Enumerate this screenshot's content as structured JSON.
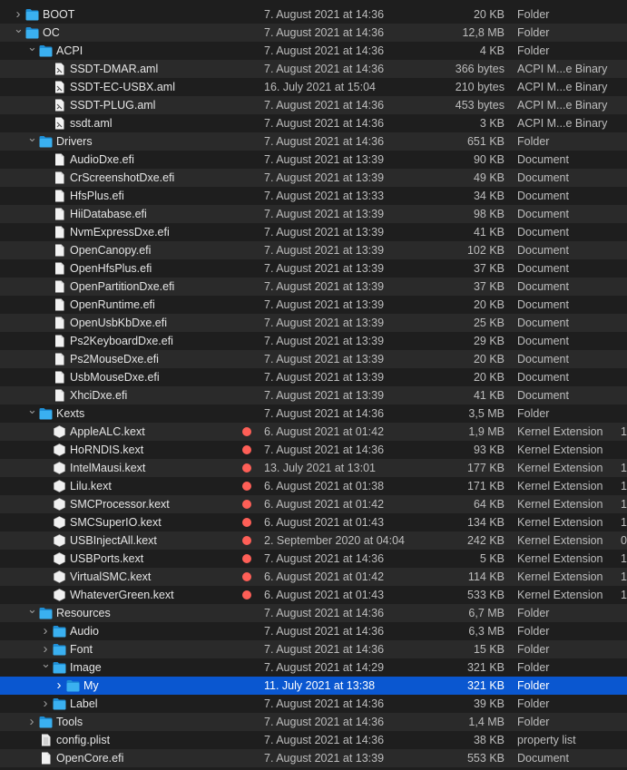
{
  "colors": {
    "folder": "#3ab0f0",
    "selection": "#0a57d0",
    "tag_red": "#fe5f57"
  },
  "rows": [
    {
      "level": 0,
      "icon": "folder",
      "disclosure": "collapsed",
      "name": "BOOT",
      "date": "7. August 2021 at 14:36",
      "size": "20 KB",
      "kind": "Folder"
    },
    {
      "level": 0,
      "icon": "folder",
      "disclosure": "expanded",
      "name": "OC",
      "date": "7. August 2021 at 14:36",
      "size": "12,8 MB",
      "kind": "Folder"
    },
    {
      "level": 1,
      "icon": "folder",
      "disclosure": "expanded",
      "name": "ACPI",
      "date": "7. August 2021 at 14:36",
      "size": "4 KB",
      "kind": "Folder"
    },
    {
      "level": 2,
      "icon": "aml",
      "name": "SSDT-DMAR.aml",
      "date": "7. August 2021 at 14:36",
      "size": "366 bytes",
      "kind": "ACPI M...e Binary"
    },
    {
      "level": 2,
      "icon": "aml",
      "name": "SSDT-EC-USBX.aml",
      "date": "16. July 2021 at 15:04",
      "size": "210 bytes",
      "kind": "ACPI M...e Binary"
    },
    {
      "level": 2,
      "icon": "aml",
      "name": "SSDT-PLUG.aml",
      "date": "7. August 2021 at 14:36",
      "size": "453 bytes",
      "kind": "ACPI M...e Binary"
    },
    {
      "level": 2,
      "icon": "aml",
      "name": "ssdt.aml",
      "date": "7. August 2021 at 14:36",
      "size": "3 KB",
      "kind": "ACPI M...e Binary"
    },
    {
      "level": 1,
      "icon": "folder",
      "disclosure": "expanded",
      "name": "Drivers",
      "date": "7. August 2021 at 14:36",
      "size": "651 KB",
      "kind": "Folder"
    },
    {
      "level": 2,
      "icon": "doc",
      "name": "AudioDxe.efi",
      "date": "7. August 2021 at 13:39",
      "size": "90 KB",
      "kind": "Document"
    },
    {
      "level": 2,
      "icon": "doc",
      "name": "CrScreenshotDxe.efi",
      "date": "7. August 2021 at 13:39",
      "size": "49 KB",
      "kind": "Document"
    },
    {
      "level": 2,
      "icon": "doc",
      "name": "HfsPlus.efi",
      "date": "7. August 2021 at 13:33",
      "size": "34 KB",
      "kind": "Document"
    },
    {
      "level": 2,
      "icon": "doc",
      "name": "HiiDatabase.efi",
      "date": "7. August 2021 at 13:39",
      "size": "98 KB",
      "kind": "Document"
    },
    {
      "level": 2,
      "icon": "doc",
      "name": "NvmExpressDxe.efi",
      "date": "7. August 2021 at 13:39",
      "size": "41 KB",
      "kind": "Document"
    },
    {
      "level": 2,
      "icon": "doc",
      "name": "OpenCanopy.efi",
      "date": "7. August 2021 at 13:39",
      "size": "102 KB",
      "kind": "Document"
    },
    {
      "level": 2,
      "icon": "doc",
      "name": "OpenHfsPlus.efi",
      "date": "7. August 2021 at 13:39",
      "size": "37 KB",
      "kind": "Document"
    },
    {
      "level": 2,
      "icon": "doc",
      "name": "OpenPartitionDxe.efi",
      "date": "7. August 2021 at 13:39",
      "size": "37 KB",
      "kind": "Document"
    },
    {
      "level": 2,
      "icon": "doc",
      "name": "OpenRuntime.efi",
      "date": "7. August 2021 at 13:39",
      "size": "20 KB",
      "kind": "Document"
    },
    {
      "level": 2,
      "icon": "doc",
      "name": "OpenUsbKbDxe.efi",
      "date": "7. August 2021 at 13:39",
      "size": "25 KB",
      "kind": "Document"
    },
    {
      "level": 2,
      "icon": "doc",
      "name": "Ps2KeyboardDxe.efi",
      "date": "7. August 2021 at 13:39",
      "size": "29 KB",
      "kind": "Document"
    },
    {
      "level": 2,
      "icon": "doc",
      "name": "Ps2MouseDxe.efi",
      "date": "7. August 2021 at 13:39",
      "size": "20 KB",
      "kind": "Document"
    },
    {
      "level": 2,
      "icon": "doc",
      "name": "UsbMouseDxe.efi",
      "date": "7. August 2021 at 13:39",
      "size": "20 KB",
      "kind": "Document"
    },
    {
      "level": 2,
      "icon": "doc",
      "name": "XhciDxe.efi",
      "date": "7. August 2021 at 13:39",
      "size": "41 KB",
      "kind": "Document"
    },
    {
      "level": 1,
      "icon": "folder",
      "disclosure": "expanded",
      "name": "Kexts",
      "date": "7. August 2021 at 14:36",
      "size": "3,5 MB",
      "kind": "Folder"
    },
    {
      "level": 2,
      "icon": "kext",
      "tag": "red",
      "name": "AppleALC.kext",
      "date": "6. August 2021 at 01:42",
      "size": "1,9 MB",
      "kind": "Kernel Extension",
      "extra": "1"
    },
    {
      "level": 2,
      "icon": "kext",
      "tag": "red",
      "name": "HoRNDIS.kext",
      "date": "7. August 2021 at 14:36",
      "size": "93 KB",
      "kind": "Kernel Extension"
    },
    {
      "level": 2,
      "icon": "kext",
      "tag": "red",
      "name": "IntelMausi.kext",
      "date": "13. July 2021 at 13:01",
      "size": "177 KB",
      "kind": "Kernel Extension",
      "extra": "1"
    },
    {
      "level": 2,
      "icon": "kext",
      "tag": "red",
      "name": "Lilu.kext",
      "date": "6. August 2021 at 01:38",
      "size": "171 KB",
      "kind": "Kernel Extension",
      "extra": "1"
    },
    {
      "level": 2,
      "icon": "kext",
      "tag": "red",
      "name": "SMCProcessor.kext",
      "date": "6. August 2021 at 01:42",
      "size": "64 KB",
      "kind": "Kernel Extension",
      "extra": "1"
    },
    {
      "level": 2,
      "icon": "kext",
      "tag": "red",
      "name": "SMCSuperIO.kext",
      "date": "6. August 2021 at 01:43",
      "size": "134 KB",
      "kind": "Kernel Extension",
      "extra": "1"
    },
    {
      "level": 2,
      "icon": "kext",
      "tag": "red",
      "name": "USBInjectAll.kext",
      "date": "2. September 2020 at 04:04",
      "size": "242 KB",
      "kind": "Kernel Extension",
      "extra": "0"
    },
    {
      "level": 2,
      "icon": "kext",
      "tag": "red",
      "name": "USBPorts.kext",
      "date": "7. August 2021 at 14:36",
      "size": "5 KB",
      "kind": "Kernel Extension",
      "extra": "1"
    },
    {
      "level": 2,
      "icon": "kext",
      "tag": "red",
      "name": "VirtualSMC.kext",
      "date": "6. August 2021 at 01:42",
      "size": "114 KB",
      "kind": "Kernel Extension",
      "extra": "1"
    },
    {
      "level": 2,
      "icon": "kext",
      "tag": "red",
      "name": "WhateverGreen.kext",
      "date": "6. August 2021 at 01:43",
      "size": "533 KB",
      "kind": "Kernel Extension",
      "extra": "1"
    },
    {
      "level": 1,
      "icon": "folder",
      "disclosure": "expanded",
      "name": "Resources",
      "date": "7. August 2021 at 14:36",
      "size": "6,7 MB",
      "kind": "Folder"
    },
    {
      "level": 2,
      "icon": "folder",
      "disclosure": "collapsed",
      "name": "Audio",
      "date": "7. August 2021 at 14:36",
      "size": "6,3 MB",
      "kind": "Folder"
    },
    {
      "level": 2,
      "icon": "folder",
      "disclosure": "collapsed",
      "name": "Font",
      "date": "7. August 2021 at 14:36",
      "size": "15 KB",
      "kind": "Folder"
    },
    {
      "level": 2,
      "icon": "folder",
      "disclosure": "expanded",
      "name": "Image",
      "date": "7. August 2021 at 14:29",
      "size": "321 KB",
      "kind": "Folder"
    },
    {
      "level": 3,
      "icon": "folder",
      "disclosure": "collapsed",
      "selected": true,
      "name": "My",
      "date": "11. July 2021 at 13:38",
      "size": "321 KB",
      "kind": "Folder"
    },
    {
      "level": 2,
      "icon": "folder",
      "disclosure": "collapsed",
      "name": "Label",
      "date": "7. August 2021 at 14:36",
      "size": "39 KB",
      "kind": "Folder"
    },
    {
      "level": 1,
      "icon": "folder",
      "disclosure": "collapsed",
      "name": "Tools",
      "date": "7. August 2021 at 14:36",
      "size": "1,4 MB",
      "kind": "Folder"
    },
    {
      "level": 1,
      "icon": "plist",
      "name": "config.plist",
      "date": "7. August 2021 at 14:36",
      "size": "38 KB",
      "kind": "property list"
    },
    {
      "level": 1,
      "icon": "doc",
      "name": "OpenCore.efi",
      "date": "7. August 2021 at 13:39",
      "size": "553 KB",
      "kind": "Document"
    }
  ]
}
